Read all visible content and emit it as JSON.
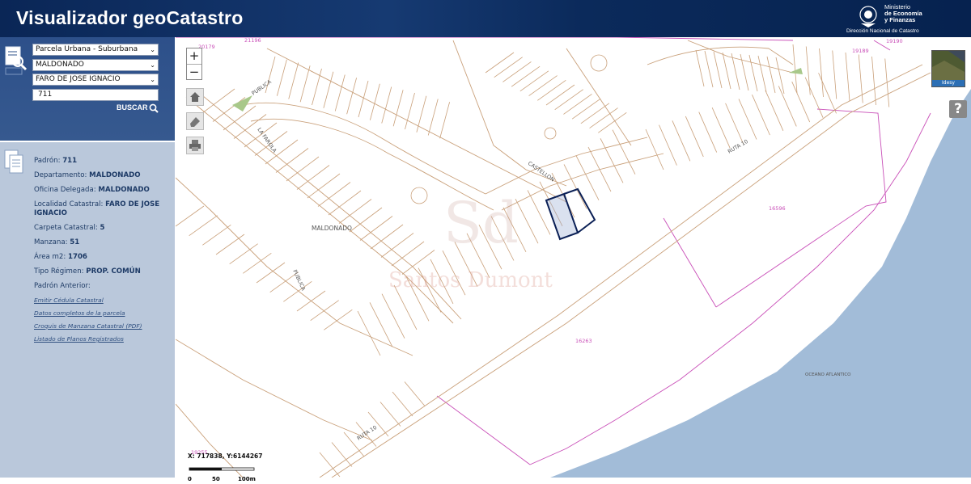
{
  "header": {
    "title": "Visualizador geoCatastro",
    "ministry": {
      "line1": "Ministerio",
      "line2": "de Economía",
      "line3": "y Finanzas",
      "dept": "Dirección Nacional de Catastro"
    }
  },
  "search": {
    "tipo": "Parcela Urbana - Suburbana",
    "departamento": "MALDONADO",
    "localidad": "FARO DE JOSE IGNACIO",
    "padron": "711",
    "button_label": "BUSCAR"
  },
  "info": {
    "rows": [
      {
        "label": "Padrón:",
        "value": "711"
      },
      {
        "label": "Departamento:",
        "value": "MALDONADO"
      },
      {
        "label": "Oficina Delegada:",
        "value": "MALDONADO"
      },
      {
        "label": "Localidad Catastral:",
        "value": "FARO DE JOSE IGNACIO"
      },
      {
        "label": "Carpeta Catastral:",
        "value": "5"
      },
      {
        "label": "Manzana:",
        "value": "51"
      },
      {
        "label": "Área m2:",
        "value": "1706"
      },
      {
        "label": "Tipo Régimen:",
        "value": "PROP. COMÚN"
      },
      {
        "label": "Padrón Anterior:",
        "value": ""
      }
    ],
    "links": [
      "Emitir Cédula Catastral",
      "Datos completos de la parcela",
      "Croquis de Manzana Catastral (PDF)",
      "Listado de Planos Registrados"
    ]
  },
  "map": {
    "zoom_in": "+",
    "zoom_out": "−",
    "layer_label": "Idesy",
    "help_label": "?",
    "coords": "X: 717838, Y:6144267",
    "scale_labels": [
      "0",
      "50",
      "100m"
    ],
    "labels": {
      "maldonado": "MALDONADO",
      "publica1": "PUBLICA",
      "publica2": "PUBLICA",
      "lafarola": "LA FAROLA",
      "ruta10a": "RUTA 10",
      "ruta10b": "RUTA 10",
      "castellon": "CASTELLON",
      "ocean": "OCEANO ATLANTICO",
      "p16596": "16596",
      "p16263": "16263",
      "p19189": "19189",
      "p19190": "19190",
      "p20179": "20179",
      "p21196": "21196",
      "p19255": "19255",
      "watermark_initials": "Sd",
      "watermark_name": "Santos Dumont"
    }
  },
  "colors": {
    "header": "#0b2a5b",
    "search_panel": "#2e5289",
    "info_panel": "#bac8db",
    "parcel_lines": "#c9a07a",
    "pink_lines": "#c94fb8",
    "ocean": "#a2bcd8",
    "selected_parcel": "#0a1f55"
  }
}
